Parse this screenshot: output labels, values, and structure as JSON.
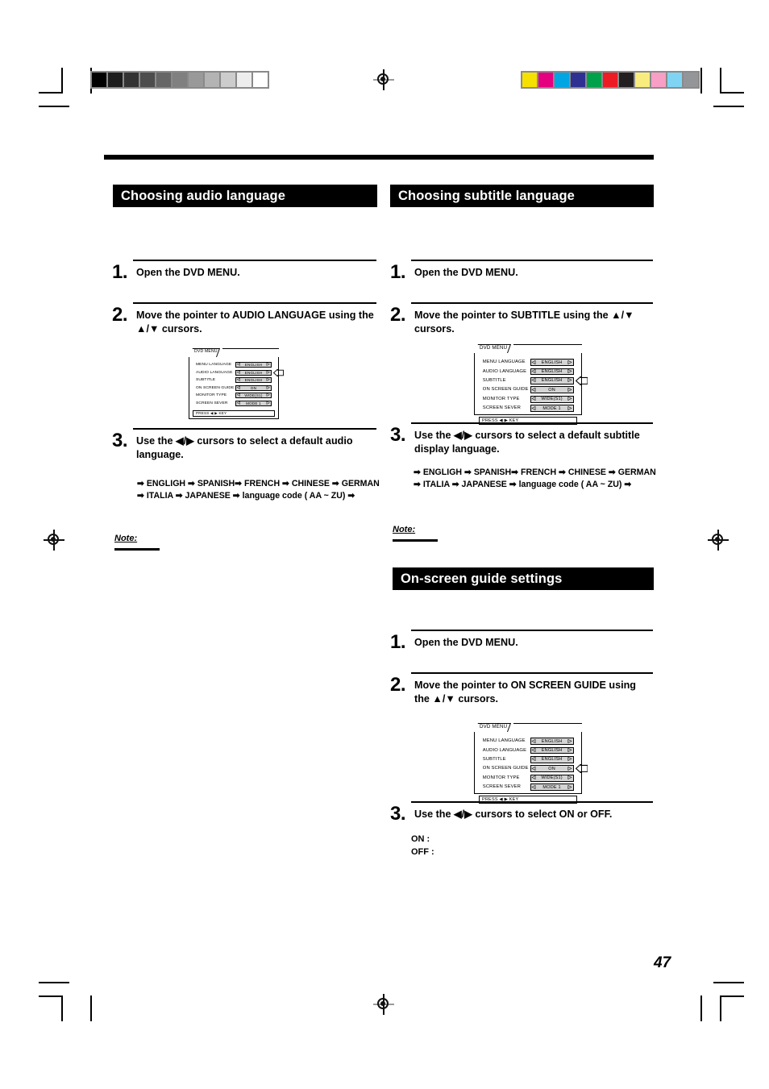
{
  "page": {
    "number": "47"
  },
  "print_marks": {
    "gray_wedge": [
      "#000000",
      "#1d1d1d",
      "#333333",
      "#4d4d4d",
      "#666666",
      "#808080",
      "#999999",
      "#b3b3b3",
      "#cccccc",
      "#ededed",
      "#ffffff"
    ],
    "color_bars": [
      "#f5e000",
      "#e5007f",
      "#00a5e3",
      "#2e3192",
      "#00a14b",
      "#ed1c24",
      "#231f20",
      "#f9ec7e",
      "#f79fc4",
      "#7fd4f4",
      "#939598"
    ],
    "registration_icon": "registration-target-icon"
  },
  "sections": [
    {
      "id": "audio",
      "title": "Choosing audio language",
      "steps": [
        {
          "num": "1.",
          "text": "Open the DVD MENU."
        },
        {
          "num": "2.",
          "text": "Move the pointer to AUDIO LANGUAGE using the ▲/▼ cursors."
        },
        {
          "num": "3.",
          "text": "Use the ◀/▶ cursors to select a default audio language."
        }
      ],
      "language_chain": [
        "➡ ENGLIGH ➡ SPANISH➡ FRENCH ➡ CHINESE ➡ GERMAN",
        "➡ ITALIA ➡ JAPANESE ➡ language code ( AA ~ ZU) ➡"
      ],
      "note_label": "Note:"
    },
    {
      "id": "subtitle",
      "title": "Choosing subtitle language",
      "steps": [
        {
          "num": "1.",
          "text": "Open the DVD MENU."
        },
        {
          "num": "2.",
          "text": "Move the pointer to SUBTITLE using the ▲/▼ cursors."
        },
        {
          "num": "3.",
          "text": "Use the ◀/▶ cursors to select a default subtitle display language."
        }
      ],
      "language_chain": [
        "➡ ENGLIGH ➡ SPANISH➡ FRENCH ➡ CHINESE ➡ GERMAN",
        "➡ ITALIA ➡ JAPANESE ➡ language code ( AA ~ ZU) ➡"
      ],
      "note_label": "Note:"
    },
    {
      "id": "onscreen",
      "title": "On-screen guide settings",
      "steps": [
        {
          "num": "1.",
          "text": "Open the DVD MENU."
        },
        {
          "num": "2.",
          "text": "Move the pointer to ON SCREEN GUIDE using the ▲/▼ cursors."
        },
        {
          "num": "3.",
          "text": "Use the ◀/▶ cursors to select ON or OFF."
        }
      ],
      "on_off": {
        "on": "ON  :",
        "off": "OFF :"
      }
    }
  ],
  "dvd_menu": {
    "tab_label": "DVD MENU",
    "press_key": "PRESS ◀ ▶ KEY",
    "rows": [
      {
        "label": "MENU LANGUAGE",
        "value": "ENGLISH"
      },
      {
        "label": "AUDIO LANGUAGE",
        "value": "ENGLISH"
      },
      {
        "label": "SUBTITLE",
        "value": "ENGLISH"
      },
      {
        "label": "ON SCREEN GUIDE",
        "value": "ON"
      },
      {
        "label": "MONITOR TYPE",
        "value": "WIDE(S1)"
      },
      {
        "label": "SCREEN SEVER",
        "value": "MODE 1"
      }
    ],
    "instances": [
      {
        "id": "audio-menu",
        "highlight_row_index": 1
      },
      {
        "id": "subtitle-menu",
        "highlight_row_index": 2
      },
      {
        "id": "onscreen-menu",
        "highlight_row_index": 3
      }
    ]
  }
}
